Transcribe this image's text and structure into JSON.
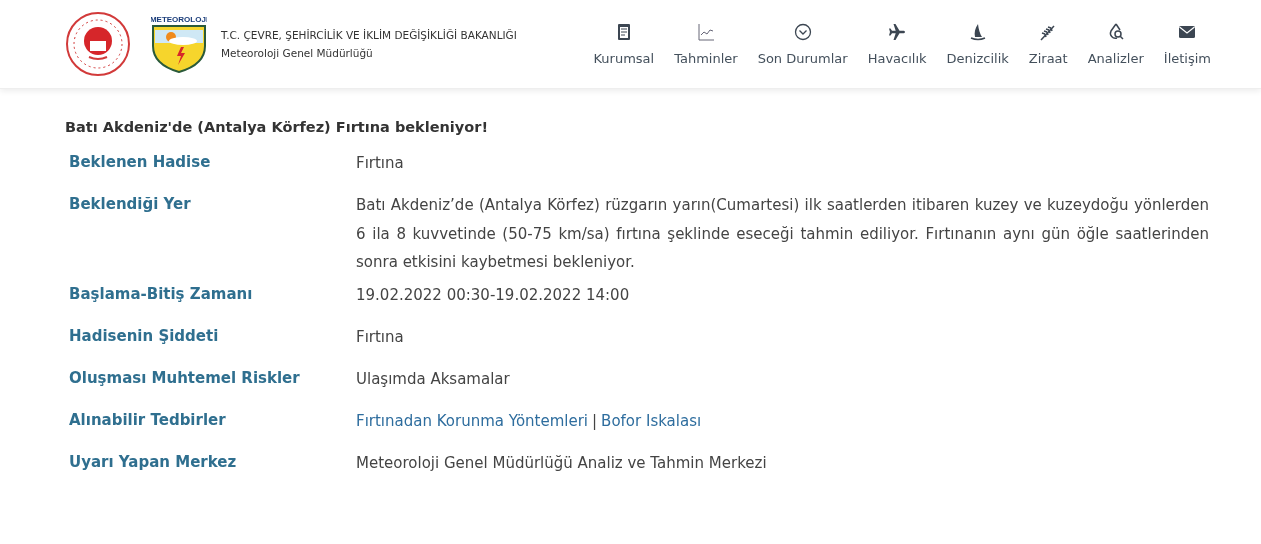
{
  "header": {
    "logo_text": "METEOROLOJI",
    "ministry": "T.C. ÇEVRE, ŞEHİRCİLİK VE İKLİM DEĞİŞİKLİĞİ BAKANLIĞI",
    "agency": "Meteoroloji Genel Müdürlüğü"
  },
  "nav": [
    {
      "label": "Kurumsal"
    },
    {
      "label": "Tahminler"
    },
    {
      "label": "Son Durumlar"
    },
    {
      "label": "Havacılık"
    },
    {
      "label": "Denizcilik"
    },
    {
      "label": "Ziraat"
    },
    {
      "label": "Analizler"
    },
    {
      "label": "İletişim"
    }
  ],
  "title": "Batı Akdeniz'de (Antalya Körfez) Fırtına bekleniyor!",
  "rows": [
    {
      "label": "Beklenen Hadise",
      "kind": "text",
      "value": "Fırtına"
    },
    {
      "label": "Beklendiği Yer",
      "kind": "text",
      "value": "Batı Akdeniz’de (Antalya Körfez) rüzgarın yarın(Cumartesi) ilk saatlerden itibaren kuzey ve kuzeydoğu yönlerden 6 ila 8 kuvvetinde (50-75 km/sa) fırtına şeklinde eseceği tahmin ediliyor. Fırtınanın aynı gün öğle saatlerinden sonra etkisini kaybetmesi bekleniyor."
    },
    {
      "label": "Başlama-Bitiş Zamanı",
      "kind": "text",
      "value": "19.02.2022 00:30-19.02.2022 14:00"
    },
    {
      "label": "Hadisenin Şiddeti",
      "kind": "text",
      "value": "Fırtına"
    },
    {
      "label": "Oluşması Muhtemel Riskler",
      "kind": "text",
      "value": "Ulaşımda Aksamalar"
    },
    {
      "label": "Alınabilir Tedbirler",
      "kind": "links",
      "links": [
        "Fırtınadan Korunma Yöntemleri",
        "Bofor Iskalası"
      ],
      "separator": "|"
    },
    {
      "label": "Uyarı Yapan Merkez",
      "kind": "text",
      "value": "Meteoroloji Genel Müdürlüğü Analiz ve Tahmin Merkezi"
    }
  ]
}
